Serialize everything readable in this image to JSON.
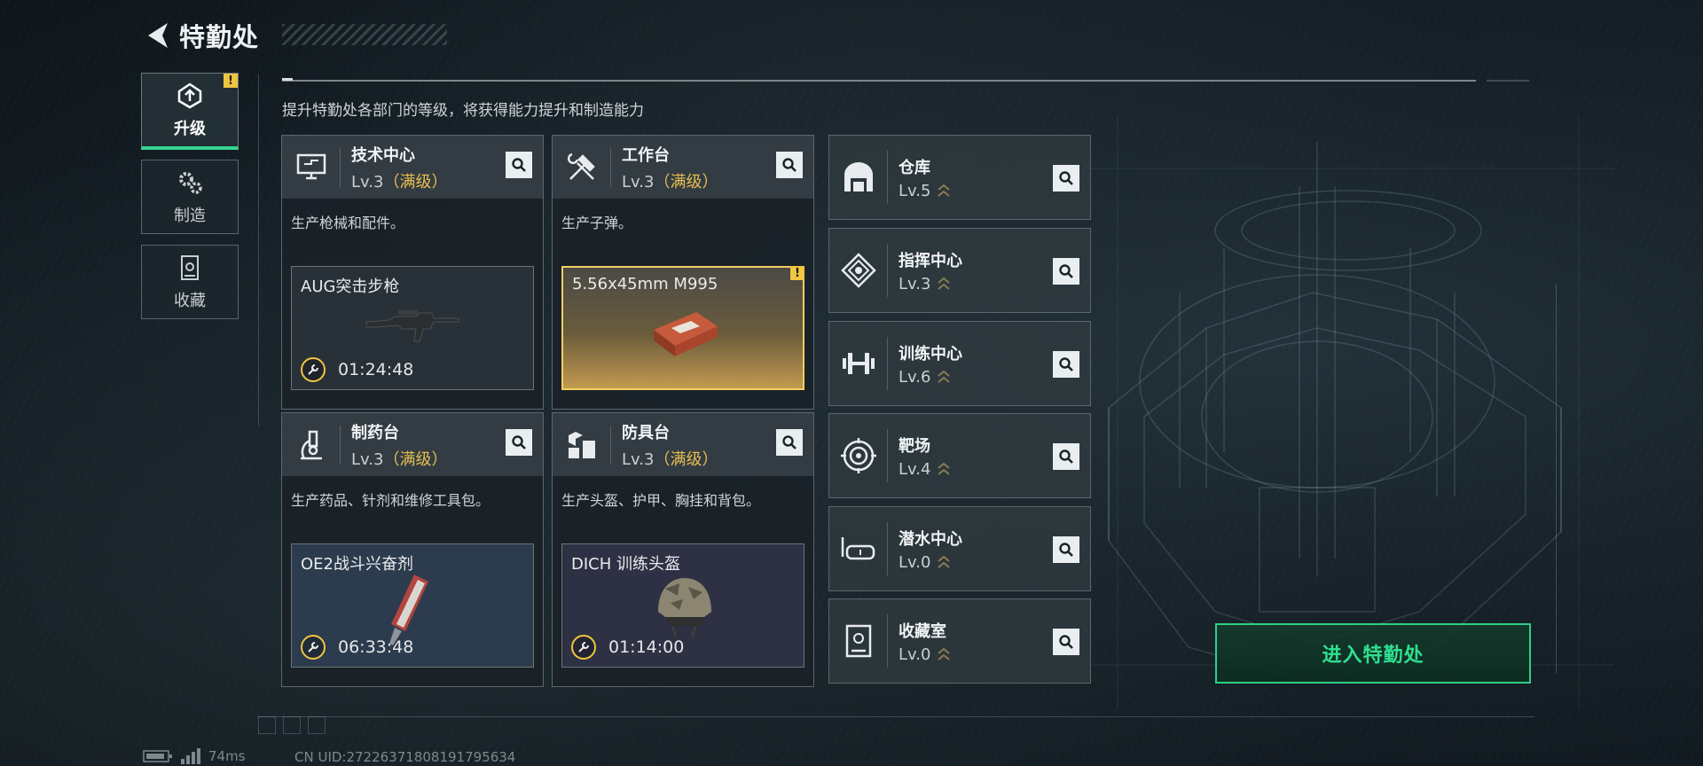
{
  "header": {
    "title": "特勤处"
  },
  "nav": [
    {
      "label": "升级",
      "icon": "upgrade-icon",
      "active": true,
      "badge": "!"
    },
    {
      "label": "制造",
      "icon": "gears-icon",
      "active": false
    },
    {
      "label": "收藏",
      "icon": "collection-icon",
      "active": false
    }
  ],
  "subtitle": "提升特勤处各部门的等级，将获得能力提升和制造能力",
  "cards": [
    {
      "name": "技术中心",
      "level": "Lv.3",
      "status": "（满级）",
      "desc": "生产枪械和配件。",
      "product": "AUG突击步枪",
      "timer": "01:24:48"
    },
    {
      "name": "工作台",
      "level": "Lv.3",
      "status": "（满级）",
      "desc": "生产子弹。",
      "product": "5.56x45mm M995",
      "badge": "!"
    },
    {
      "name": "制药台",
      "level": "Lv.3",
      "status": "（满级）",
      "desc": "生产药品、针剂和维修工具包。",
      "product": "OE2战斗兴奋剂",
      "timer": "06:33:48"
    },
    {
      "name": "防具台",
      "level": "Lv.3",
      "status": "（满级）",
      "desc": "生产头盔、护甲、胸挂和背包。",
      "product": "DICH 训练头盔",
      "timer": "01:14:00"
    }
  ],
  "rooms": [
    {
      "name": "仓库",
      "level": "Lv.5",
      "icon": "warehouse-icon"
    },
    {
      "name": "指挥中心",
      "level": "Lv.3",
      "icon": "command-center-icon"
    },
    {
      "name": "训练中心",
      "level": "Lv.6",
      "icon": "dumbbell-icon"
    },
    {
      "name": "靶场",
      "level": "Lv.4",
      "icon": "target-icon"
    },
    {
      "name": "潜水中心",
      "level": "Lv.0",
      "icon": "diving-mask-icon"
    },
    {
      "name": "收藏室",
      "level": "Lv.0",
      "icon": "collection-room-icon"
    }
  ],
  "enter_button": "进入特勤处",
  "status": {
    "ping": "74ms",
    "uid": "CN UID:27226371808191795634"
  },
  "colors": {
    "accent_green": "#2fcf86",
    "gold": "#e6bf4e",
    "badge_yellow": "#f0c542"
  }
}
